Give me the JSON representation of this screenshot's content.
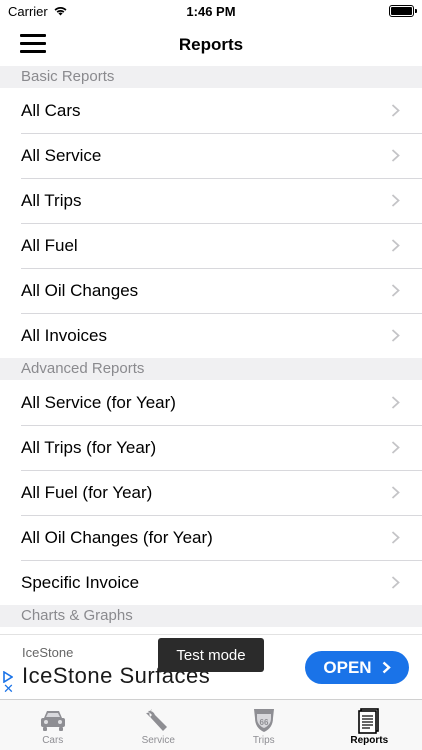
{
  "status_bar": {
    "carrier": "Carrier",
    "time": "1:46 PM"
  },
  "nav": {
    "title": "Reports"
  },
  "sections": [
    {
      "header": "Basic Reports",
      "rows": [
        "All Cars",
        "All Service",
        "All Trips",
        "All Fuel",
        "All Oil Changes",
        "All Invoices"
      ]
    },
    {
      "header": "Advanced Reports",
      "rows": [
        "All Service (for Year)",
        "All Trips (for Year)",
        "All Fuel (for Year)",
        "All Oil Changes (for Year)",
        "Specific Invoice"
      ]
    },
    {
      "header": "Charts & Graphs",
      "rows": []
    }
  ],
  "ad": {
    "brand": "IceStone",
    "headline": "IceStone Surfaces",
    "cta": "OPEN",
    "test_badge": "Test mode",
    "close_glyph": "✕"
  },
  "tabs": [
    {
      "label": "Cars",
      "icon": "car-icon",
      "active": false
    },
    {
      "label": "Service",
      "icon": "wrench-icon",
      "active": false
    },
    {
      "label": "Trips",
      "icon": "route-66-icon",
      "active": false
    },
    {
      "label": "Reports",
      "icon": "report-icon",
      "active": true
    }
  ],
  "colors": {
    "accent": "#1a73e8",
    "section_bg": "#f0f0f2",
    "section_text": "#8a8a8e",
    "chevron": "#c4c4c7"
  }
}
